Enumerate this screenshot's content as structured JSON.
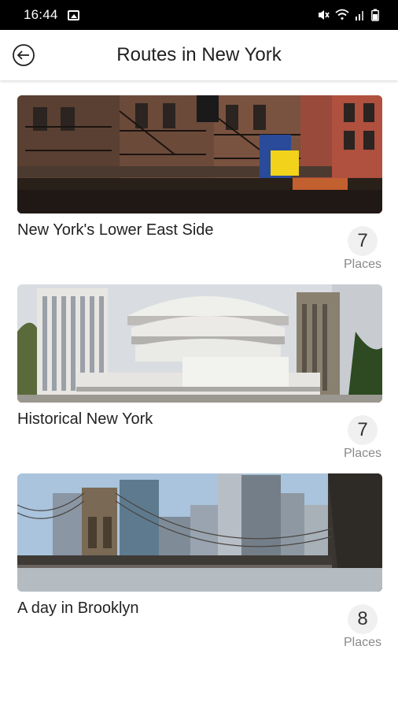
{
  "status_bar": {
    "time": "16:44",
    "icons": [
      "gallery-icon",
      "mute-icon",
      "wifi-icon",
      "signal-icon",
      "battery-icon"
    ]
  },
  "header": {
    "title": "Routes in New York",
    "back_icon": "arrow-left-circle-icon"
  },
  "routes": [
    {
      "name": "New York's Lower East Side",
      "places_count": "7",
      "places_label": "Places",
      "image": "lower-east-side-street-photo"
    },
    {
      "name": "Historical New York",
      "places_count": "7",
      "places_label": "Places",
      "image": "guggenheim-museum-photo"
    },
    {
      "name": "A day in Brooklyn",
      "places_count": "8",
      "places_label": "Places",
      "image": "brooklyn-bridge-skyline-photo"
    }
  ],
  "colors": {
    "status_bar": "#000000",
    "background": "#ffffff",
    "badge_bg": "#f0f0f0",
    "muted_text": "#888888"
  }
}
